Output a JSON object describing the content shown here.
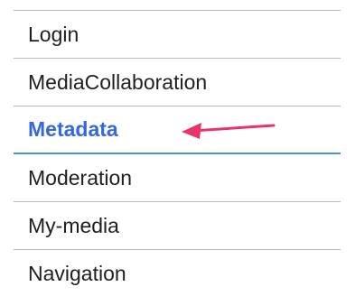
{
  "menu": {
    "items": [
      {
        "label": "Login"
      },
      {
        "label": "MediaCollaboration"
      },
      {
        "label": "Metadata",
        "active": true
      },
      {
        "label": "Moderation"
      },
      {
        "label": "My-media"
      },
      {
        "label": "Navigation"
      }
    ]
  },
  "colors": {
    "active_text": "#3468e0",
    "active_underline": "#4f8ee8",
    "arrow": "#e8336b",
    "divider": "#b9b9b9",
    "text": "#1f1f1f"
  },
  "annotation": {
    "icon": "arrow-left-icon"
  }
}
